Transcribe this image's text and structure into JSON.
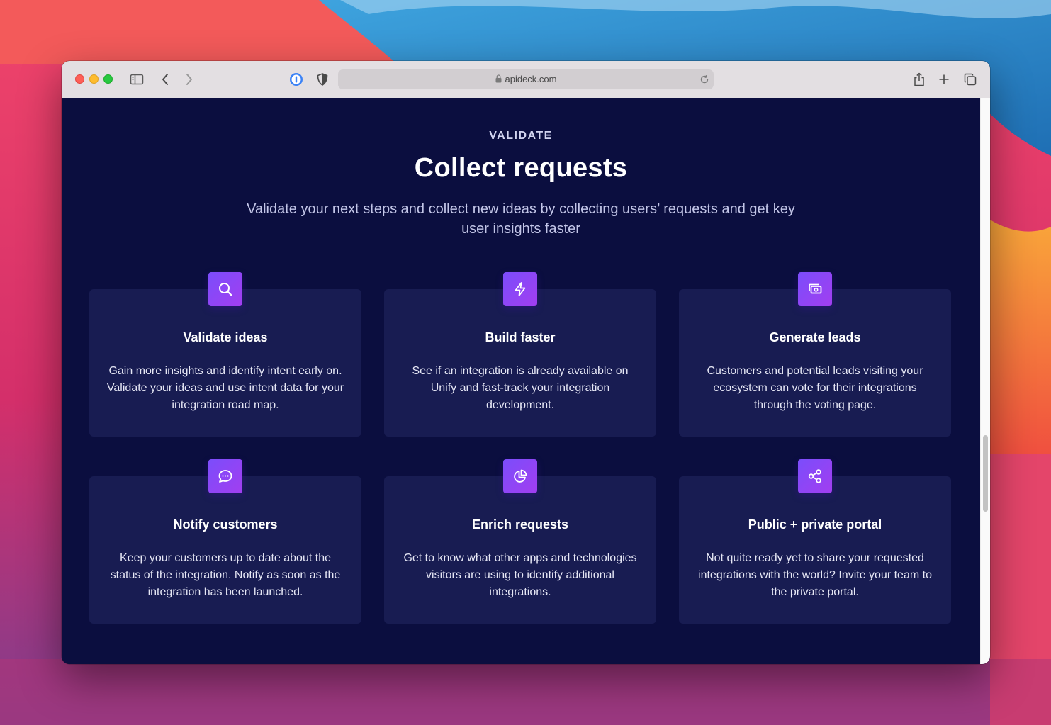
{
  "browser": {
    "url": "apideck.com"
  },
  "section": {
    "eyebrow": "VALIDATE",
    "title": "Collect requests",
    "subtitle": "Validate your next steps and collect new ideas by collecting users’ requests and get key user insights faster"
  },
  "cards": [
    {
      "icon": "search-icon",
      "title": "Validate ideas",
      "description": "Gain more insights and identify intent early on. Validate your ideas and use intent data for your integration road map."
    },
    {
      "icon": "lightning-icon",
      "title": "Build faster",
      "description": "See if an integration is already available on Unify and fast-track your integration development."
    },
    {
      "icon": "cash-icon",
      "title": "Generate leads",
      "description": "Customers and potential leads visiting your ecosystem can vote for their integrations through the voting page."
    },
    {
      "icon": "chat-icon",
      "title": "Notify customers",
      "description": "Keep your customers up to date about the status of the integration. Notify as soon as the integration has been launched."
    },
    {
      "icon": "pie-chart-icon",
      "title": "Enrich requests",
      "description": "Get to know what other apps and technologies visitors are using to identify additional integrations."
    },
    {
      "icon": "share-icon",
      "title": "Public + private portal",
      "description": "Not quite ready yet to share your requested integrations with the world? Invite your team to the private portal."
    }
  ],
  "colors": {
    "page_background": "#0b0e3f",
    "card_background": "#181c52",
    "icon_gradient_start": "#7b4dfb",
    "icon_gradient_end": "#a23ef0"
  }
}
